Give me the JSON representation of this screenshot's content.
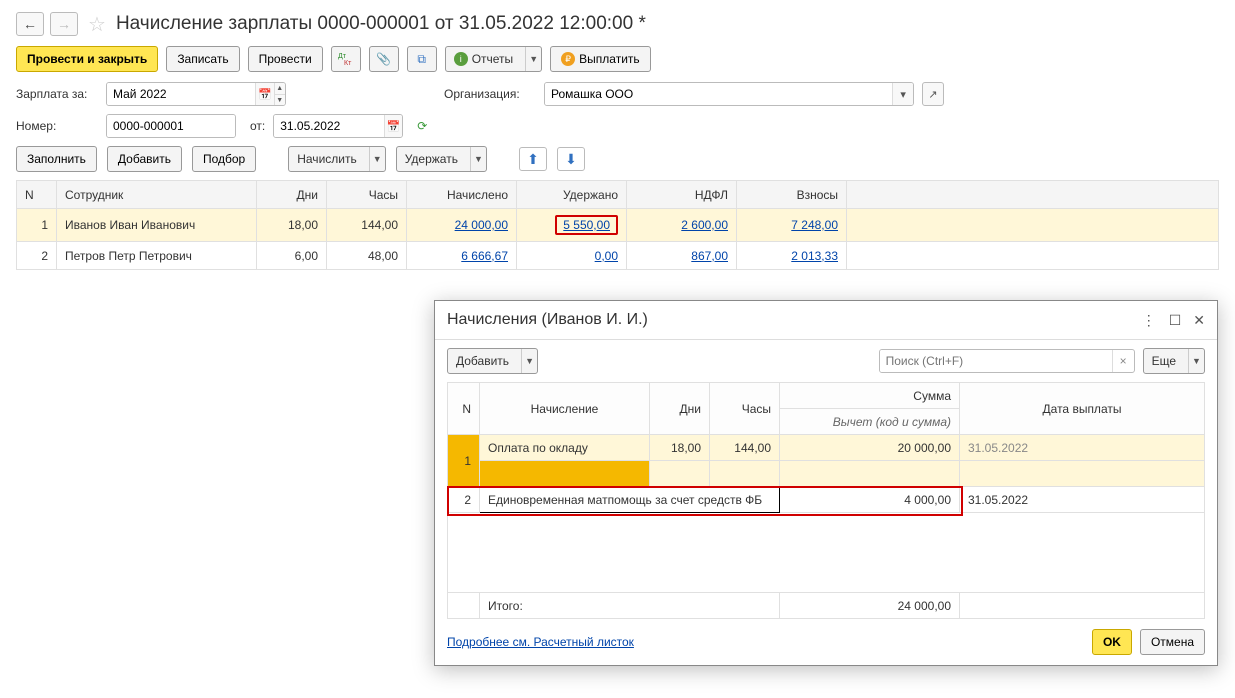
{
  "header": {
    "title": "Начисление зарплаты 0000-000001 от 31.05.2022 12:00:00 *"
  },
  "toolbar": {
    "post_close": "Провести и закрыть",
    "save": "Записать",
    "post": "Провести",
    "reports": "Отчеты",
    "pay": "Выплатить"
  },
  "form": {
    "salary_for_label": "Зарплата за:",
    "salary_for_value": "Май 2022",
    "org_label": "Организация:",
    "org_value": "Ромашка ООО",
    "number_label": "Номер:",
    "number_value": "0000-000001",
    "from_label": "от:",
    "from_value": "31.05.2022"
  },
  "tablebar": {
    "fill": "Заполнить",
    "add": "Добавить",
    "pick": "Подбор",
    "accrue": "Начислить",
    "deduct": "Удержать"
  },
  "cols": {
    "n": "N",
    "employee": "Сотрудник",
    "days": "Дни",
    "hours": "Часы",
    "accrued": "Начислено",
    "deducted": "Удержано",
    "ndfl": "НДФЛ",
    "contrib": "Взносы"
  },
  "rows": [
    {
      "n": "1",
      "emp": "Иванов Иван Иванович",
      "days": "18,00",
      "hours": "144,00",
      "accrued": "24 000,00",
      "deducted": "5 550,00",
      "ndfl": "2 600,00",
      "contrib": "7 248,00",
      "selected": true,
      "deducted_red": true
    },
    {
      "n": "2",
      "emp": "Петров Петр Петрович",
      "days": "6,00",
      "hours": "48,00",
      "accrued": "6 666,67",
      "deducted": "0,00",
      "ndfl": "867,00",
      "contrib": "2 013,33",
      "selected": false
    }
  ],
  "modal": {
    "title": "Начисления (Иванов И. И.)",
    "add": "Добавить",
    "search_ph": "Поиск (Ctrl+F)",
    "more": "Еще",
    "cols": {
      "n": "N",
      "accrual": "Начисление",
      "days": "Дни",
      "hours": "Часы",
      "sum": "Сумма",
      "paydate": "Дата выплаты",
      "deduction": "Вычет (код и сумма)"
    },
    "rows": [
      {
        "n": "1",
        "name": "Оплата по окладу",
        "days": "18,00",
        "hours": "144,00",
        "sum": "20 000,00",
        "date": "31.05.2022",
        "selected": true,
        "muted_date": true
      },
      {
        "n": "2",
        "name": "Единовременная матпомощь за счет средств ФБ",
        "days": "",
        "hours": "",
        "sum": "4 000,00",
        "date": "31.05.2022",
        "selected": false,
        "editable": true
      }
    ],
    "total_label": "Итого:",
    "total_sum": "24 000,00",
    "link": "Подробнее см. Расчетный листок",
    "ok": "OK",
    "cancel": "Отмена"
  }
}
